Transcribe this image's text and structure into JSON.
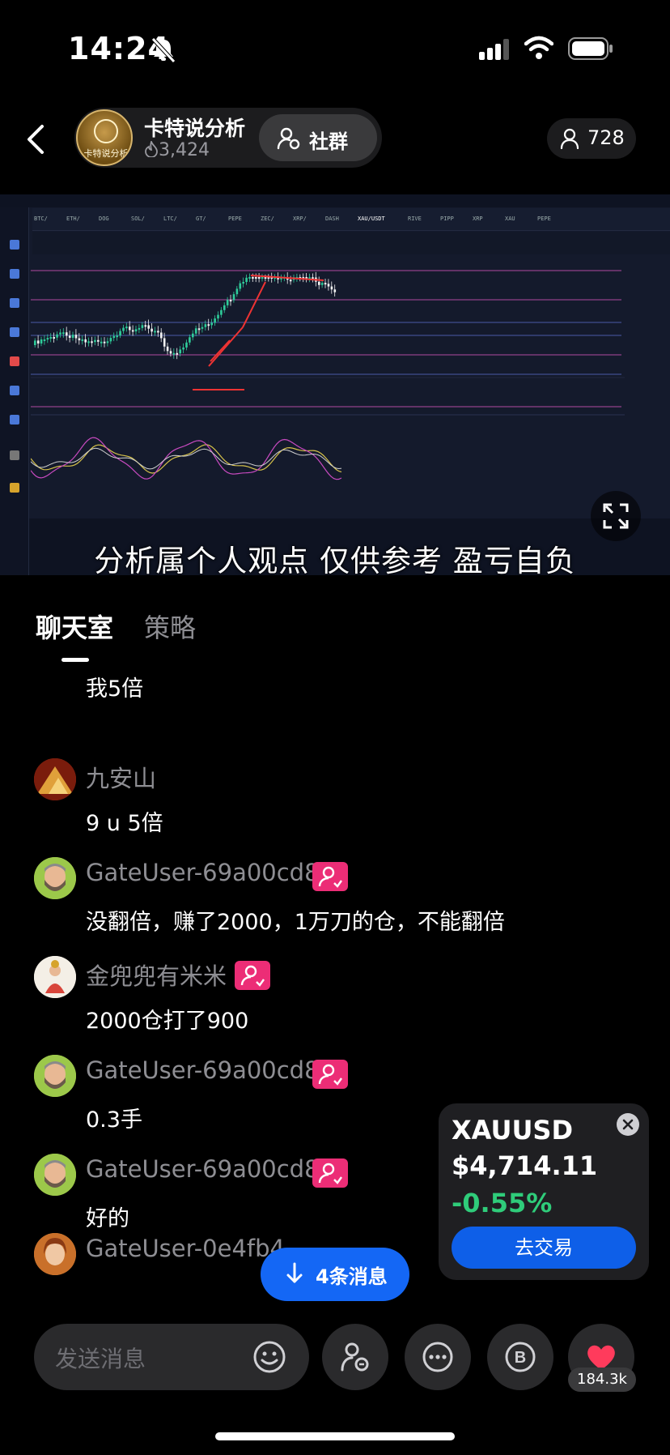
{
  "status_bar": {
    "time": "14:24"
  },
  "header": {
    "streamer_name": "卡特说分析",
    "streamer_logo_text": "卡特说分析",
    "likes": "3,424",
    "group_label": "社群",
    "viewer_count": "728"
  },
  "video": {
    "subtitle": "分析属个人观点 仅供参考 盈亏自负",
    "tickers": [
      "BTC/",
      "ETH/",
      "DOG",
      "SOL/",
      "LTC/",
      "GT/",
      "PEPE",
      "ZEC/",
      "XRP/",
      "DASH",
      "XAU/USDT",
      "RIVE",
      "PIPP",
      "XRP",
      "XAU",
      "PEPE"
    ]
  },
  "tabs": {
    "active": "聊天室",
    "inactive": "策略"
  },
  "chat": {
    "messages": [
      {
        "nick": "",
        "text": "我5倍",
        "avatar": "dark",
        "badge": false
      },
      {
        "nick": "九安山",
        "text": "9 u 5倍",
        "avatar": "mountain",
        "badge": false
      },
      {
        "nick": "GateUser-69a00cd8",
        "text": "没翻倍，赚了2000，1万刀的仓，不能翻倍",
        "avatar": "beard",
        "badge": true
      },
      {
        "nick": "金兜兜有米米",
        "text": "2000仓打了900",
        "avatar": "lady",
        "badge": true
      },
      {
        "nick": "GateUser-69a00cd8",
        "text": "0.3手",
        "avatar": "beard",
        "badge": true
      },
      {
        "nick": "GateUser-69a00cd8",
        "text": "好的",
        "avatar": "beard",
        "badge": true
      },
      {
        "nick": "GateUser-0e4fb4...",
        "text": "",
        "avatar": "woman",
        "badge": false
      }
    ]
  },
  "ticker_card": {
    "symbol": "XAUUSD",
    "price": "$4,714.11",
    "change": "-0.55%",
    "trade_label": "去交易"
  },
  "new_messages": "4条消息",
  "input": {
    "placeholder": "发送消息"
  },
  "like_count": "184.3k",
  "colors": {
    "accent_blue": "#1467f5",
    "up_green": "#2fcc7a",
    "heart_red": "#ff3b5c",
    "badge_pink": "#ec2d76"
  }
}
